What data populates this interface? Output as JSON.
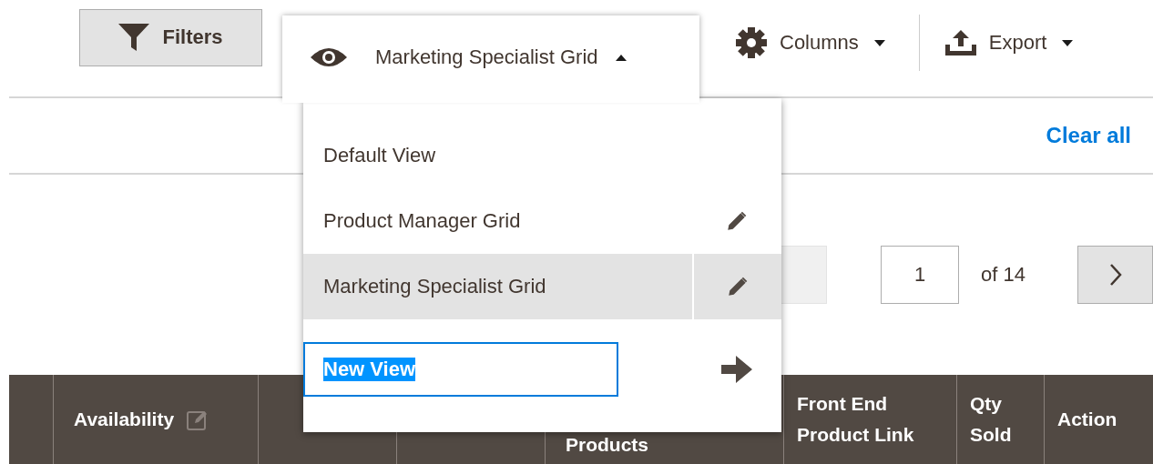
{
  "toolbar": {
    "filters_button": "Filters",
    "view_button": {
      "label": "Marketing Specialist Grid",
      "expanded": true
    },
    "columns_button": "Columns",
    "export_button": "Export"
  },
  "clear_all": "Clear all",
  "views_menu": {
    "items": [
      {
        "label": "Default View",
        "selected": false,
        "editable": false
      },
      {
        "label": "Product Manager Grid",
        "selected": false,
        "editable": true
      },
      {
        "label": "Marketing Specialist Grid",
        "selected": true,
        "editable": true
      }
    ],
    "new_view": {
      "value": "New View",
      "text_selected": true
    }
  },
  "pager": {
    "page": "1",
    "total": "of 14"
  },
  "table": {
    "columns": [
      {
        "label": "Availability",
        "editable": true
      },
      {
        "label": "Products",
        "editable": false
      },
      {
        "label": "Front End Product Link",
        "editable": false
      },
      {
        "label": "Qty Sold",
        "editable": false
      },
      {
        "label": "Action",
        "editable": false
      }
    ]
  }
}
